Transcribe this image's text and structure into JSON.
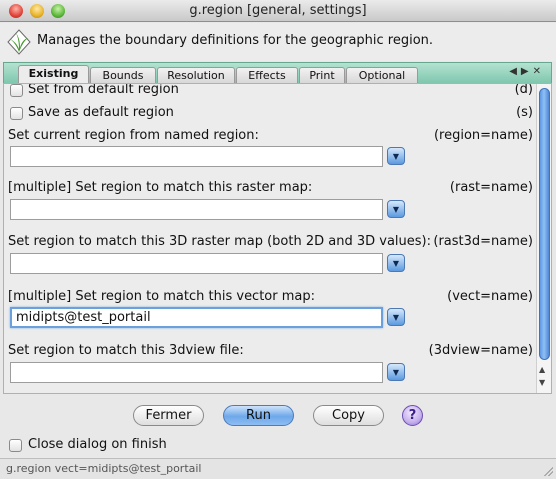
{
  "window": {
    "title": "g.region [general, settings]"
  },
  "header": {
    "description": "Manages the boundary definitions for the geographic region."
  },
  "tabs": [
    {
      "label": "Existing",
      "active": true
    },
    {
      "label": "Bounds"
    },
    {
      "label": "Resolution"
    },
    {
      "label": "Effects"
    },
    {
      "label": "Print"
    },
    {
      "label": "Optional"
    }
  ],
  "tab_nav": {
    "prev": "◀",
    "next": "▶",
    "close": "✕"
  },
  "options": {
    "default_region": {
      "label": "Set from default region",
      "flag": "(d)",
      "checked": false
    },
    "save_default": {
      "label": "Save as default region",
      "flag": "(s)",
      "checked": false
    },
    "region": {
      "label": "Set current region from named region:",
      "param": "(region=name)",
      "value": ""
    },
    "rast": {
      "label": "[multiple] Set region to match this raster map:",
      "param": "(rast=name)",
      "value": ""
    },
    "rast3d": {
      "label": "Set region to match this 3D raster map (both 2D and 3D values):",
      "param": "(rast3d=name)",
      "value": ""
    },
    "vect": {
      "label": "[multiple] Set region to match this vector map:",
      "param": "(vect=name)",
      "value": "midipts@test_portail"
    },
    "view3d": {
      "label": "Set region to match this 3dview file:",
      "param": "(3dview=name)",
      "value": ""
    }
  },
  "buttons": {
    "close": "Fermer",
    "run": "Run",
    "copy": "Copy",
    "help": "?"
  },
  "close_on_finish": {
    "label": "Close dialog on finish",
    "checked": false
  },
  "status": {
    "command": "g.region vect=midipts@test_portail"
  },
  "icons": {
    "dropdown": "▼",
    "scroll_up": "▲",
    "scroll_down": "▼"
  }
}
